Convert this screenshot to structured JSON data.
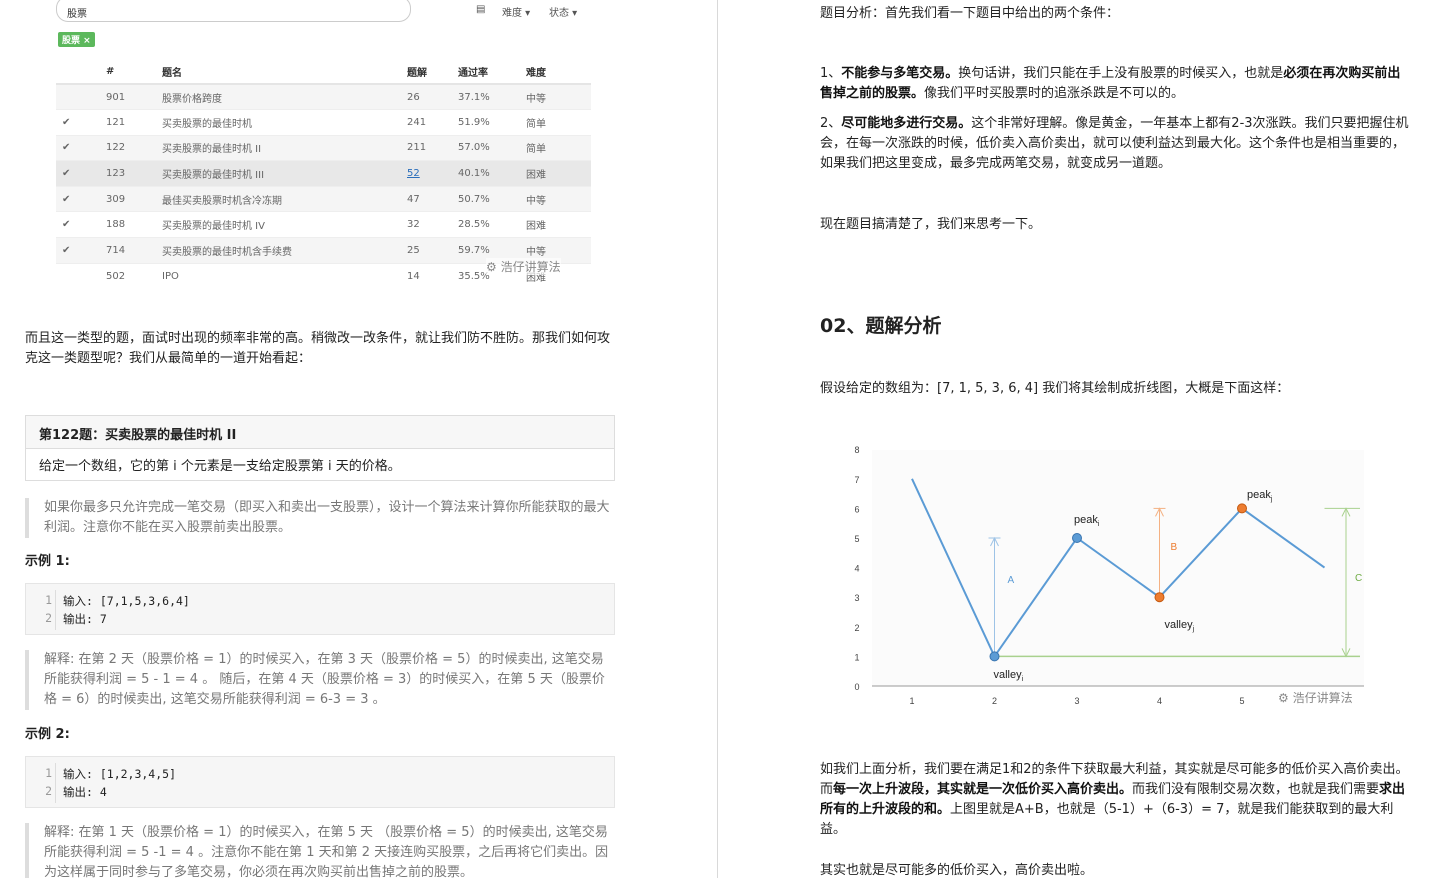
{
  "left": {
    "lc": {
      "search_value": "股票",
      "difficulty_label": "难度",
      "status_label": "状态",
      "tag": "股票 ×",
      "headers": [
        "#",
        "题名",
        "题解",
        "通过率",
        "难度"
      ],
      "rows": [
        {
          "check": "",
          "num": "901",
          "title": "股票价格跨度",
          "sol": "26",
          "rate": "37.1%",
          "diff": "中等"
        },
        {
          "check": "✔",
          "num": "121",
          "title": "买卖股票的最佳时机",
          "sol": "241",
          "rate": "51.9%",
          "diff": "简单"
        },
        {
          "check": "✔",
          "num": "122",
          "title": "买卖股票的最佳时机 II",
          "sol": "211",
          "rate": "57.0%",
          "diff": "简单"
        },
        {
          "check": "✔",
          "num": "123",
          "title": "买卖股票的最佳时机 III",
          "sol": "52",
          "rate": "40.1%",
          "diff": "困难"
        },
        {
          "check": "✔",
          "num": "309",
          "title": "最佳买卖股票时机含冷冻期",
          "sol": "47",
          "rate": "50.7%",
          "diff": "中等"
        },
        {
          "check": "✔",
          "num": "188",
          "title": "买卖股票的最佳时机 IV",
          "sol": "32",
          "rate": "28.5%",
          "diff": "困难"
        },
        {
          "check": "✔",
          "num": "714",
          "title": "买卖股票的最佳时机含手续费",
          "sol": "25",
          "rate": "59.7%",
          "diff": "中等"
        },
        {
          "check": "",
          "num": "502",
          "title": "IPO",
          "sol": "14",
          "rate": "35.5%",
          "diff": "困难"
        }
      ],
      "watermark": "浩仔讲算法"
    },
    "intro": "而且这一类型的题，面试时出现的频率非常的高。稍微改一改条件，就让我们防不胜防。那我们如何攻克这一类题型呢？我们从最简单的一道开始看起：",
    "problem_title": "第122题：买卖股票的最佳时机 II",
    "problem_desc": "给定一个数组，它的第 i 个元素是一支给定股票第 i 天的价格。",
    "quote1": "如果你最多只允许完成一笔交易（即买入和卖出一支股票），设计一个算法来计算你所能获取的最大利润。注意你不能在买入股票前卖出股票。",
    "example1_title": "示例 1:",
    "example1_lines": [
      "输入: [7,1,5,3,6,4]",
      "输出: 7"
    ],
    "explain1": "解释: 在第 2 天（股票价格 = 1）的时候买入，在第 3 天（股票价格 = 5）的时候卖出, 这笔交易所能获得利润 = 5 - 1 = 4 。 随后，在第 4 天（股票价格 = 3）的时候买入，在第 5 天（股票价格 = 6）的时候卖出, 这笔交易所能获得利润 = 6-3 = 3 。",
    "example2_title": "示例 2:",
    "example2_lines": [
      "输入: [1,2,3,4,5]",
      "输出: 4"
    ],
    "explain2": "解释: 在第 1 天（股票价格 = 1）的时候买入，在第 5 天 （股票价格 = 5）的时候卖出, 这笔交易所能获得利润 = 5 -1 = 4 。注意你不能在第 1 天和第 2 天接连购买股票，之后再将它们卖出。因为这样属于同时参与了多笔交易，你必须在再次购买前出售掉之前的股票。"
  },
  "right": {
    "p1": "题目分析：首先我们看一下题目中给出的两个条件：",
    "p2_bold1": "不能参与多笔交易。",
    "p2_pre": "1、",
    "p2_mid": "换句话讲，我们只能在手上没有股票的时候买入，也就是",
    "p2_bold2": "必须在再次购买前出售掉之前的股票。",
    "p2_end": "像我们平时买股票时的追涨杀跌是不可以的。",
    "p3_pre": "2、",
    "p3_bold": "尽可能地多进行交易。",
    "p3_text": "这个非常好理解。像是黄金，一年基本上都有2-3次涨跌。我们只要把握住机会，在每一次涨跌的时候，低价卖入高价卖出，就可以使利益达到最大化。这个条件也是相当重要的，如果我们把这里变成，最多完成两笔交易，就变成另一道题。",
    "p4": "现在题目搞清楚了，我们来思考一下。",
    "h2": "02、题解分析",
    "p5": "假设给定的数组为：[7, 1, 5, 3, 6, 4]  我们将其绘制成折线图，大概是下面这样：",
    "p6_a": "如我们上面分析，我们要在满足1和2的条件下获取最大利益，其实就是尽可能多的低价买入高价卖出。而",
    "p6_b1": "每一次上升波段，其实就是一次低价买入高价卖出。",
    "p6_c": "而我们没有限制交易次数，也就是我们需要",
    "p6_b2": "求出所有的上升波段的和。",
    "p6_d": "上图里就是A+B，也就是（5-1）+（6-3）= 7，就是我们能获取到的最大利益。",
    "p7": "其实也就是尽可能多的低价买入，高价卖出啦。",
    "watermark": "浩仔讲算法"
  },
  "chart_data": {
    "type": "line",
    "x": [
      0,
      1,
      2,
      3,
      4,
      5
    ],
    "x_tick_labels": [
      "1",
      "2",
      "3",
      "4",
      "5"
    ],
    "values": [
      7,
      1,
      5,
      3,
      6,
      4
    ],
    "ylim": [
      0,
      8
    ],
    "y_ticks": [
      0,
      1,
      2,
      3,
      4,
      5,
      6,
      7,
      8
    ],
    "labels": {
      "peak_i": "peak",
      "peak_j": "peak",
      "valley_i": "valley",
      "valley_j": "valley",
      "A": "A",
      "B": "B",
      "C": "C"
    },
    "colors": {
      "line": "#5b9bd5",
      "valley_j_point": "#ed7d31",
      "peak_j_point": "#ed7d31",
      "arrow_b": "#f4b183",
      "arrow_c": "#a9d18e",
      "arrow_a": "#9dc3e6",
      "baseline": "#a9d18e"
    }
  }
}
